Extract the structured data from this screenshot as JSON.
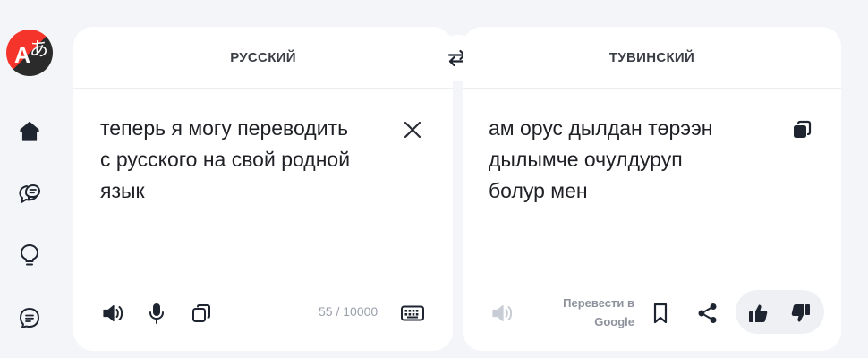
{
  "app": {
    "logo_letters": [
      "A",
      "あ"
    ]
  },
  "sidebar": {
    "items": [
      {
        "name": "home",
        "icon": "home-icon"
      },
      {
        "name": "dialog",
        "icon": "chat-bubbles-icon"
      },
      {
        "name": "ideas",
        "icon": "bulb-icon"
      },
      {
        "name": "documents",
        "icon": "doc-icon"
      }
    ]
  },
  "source": {
    "language": "РУССКИЙ",
    "text": "теперь я могу переводить\nс русского на свой родной\nязык",
    "counter": "55 / 10000"
  },
  "target": {
    "language": "ТУВИНСКИЙ",
    "text": "ам орус дылдан төрээн\nдылымче очулдуруп\nболур мен",
    "google_link": "Перевести в Google"
  },
  "colors": {
    "accent": "#f5352b",
    "icon": "#1e2531",
    "muted": "#c8ccd4",
    "background": "#f4f5f8"
  }
}
